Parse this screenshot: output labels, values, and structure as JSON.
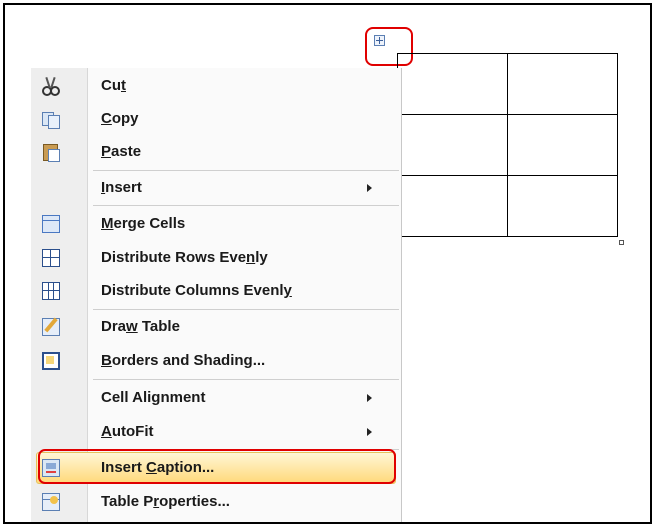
{
  "menu": {
    "items": [
      {
        "pre": "Cu",
        "key": "t",
        "post": "",
        "icon": "cut-icon",
        "submenu": false
      },
      {
        "pre": "",
        "key": "C",
        "post": "opy",
        "icon": "copy-icon",
        "submenu": false
      },
      {
        "pre": "",
        "key": "P",
        "post": "aste",
        "icon": "paste-icon",
        "submenu": false
      },
      {
        "pre": "",
        "key": "I",
        "post": "nsert",
        "icon": "",
        "submenu": true
      },
      {
        "pre": "",
        "key": "M",
        "post": "erge Cells",
        "icon": "merge-cells-icon",
        "submenu": false
      },
      {
        "pre": "Distribute Rows Eve",
        "key": "n",
        "post": "ly",
        "icon": "distribute-rows-icon",
        "submenu": false
      },
      {
        "pre": "Distribute Columns Evenl",
        "key": "y",
        "post": "",
        "icon": "distribute-columns-icon",
        "submenu": false
      },
      {
        "pre": "Dra",
        "key": "w",
        "post": " Table",
        "icon": "draw-table-icon",
        "submenu": false
      },
      {
        "pre": "",
        "key": "B",
        "post": "orders and Shading...",
        "icon": "borders-shading-icon",
        "submenu": false
      },
      {
        "pre": "Cell Ali",
        "key": "g",
        "post": "nment",
        "icon": "",
        "submenu": true
      },
      {
        "pre": "",
        "key": "A",
        "post": "utoFit",
        "icon": "",
        "submenu": true
      },
      {
        "pre": "Insert ",
        "key": "C",
        "post": "aption...",
        "icon": "insert-caption-icon",
        "submenu": false
      },
      {
        "pre": "Table P",
        "key": "r",
        "post": "operties...",
        "icon": "table-properties-icon",
        "submenu": false
      }
    ],
    "highlighted_index": 11
  },
  "table": {
    "rows": 3,
    "cols": 2
  },
  "colors": {
    "annotation_red": "#e00000",
    "highlight": "#ffd97a"
  }
}
